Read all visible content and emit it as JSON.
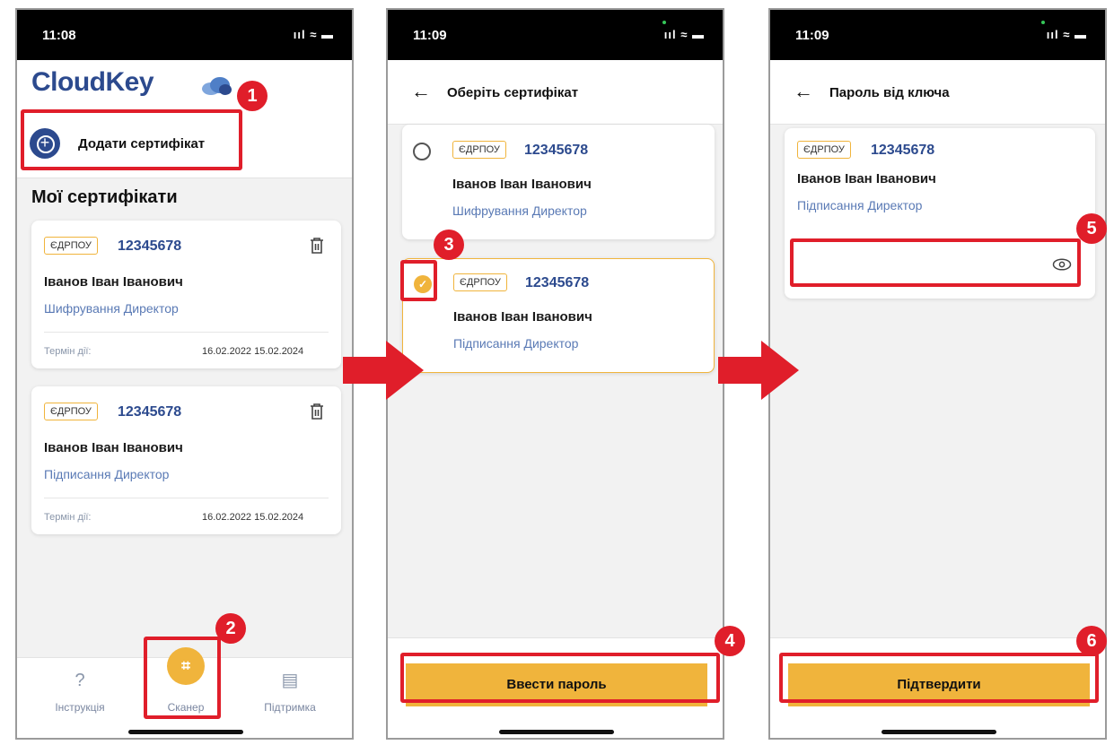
{
  "phone1": {
    "status": {
      "time": "11:08",
      "indicators": "ııl ≈ ▬"
    },
    "brand": "CloudKey",
    "add_certificate": "Додати сертифікат",
    "section_title": "Мої сертифікати",
    "cards": [
      {
        "badge": "ЄДРПОУ",
        "code": "12345678",
        "name": "Іванов Іван Іванович",
        "role": "Шифрування  Директор",
        "validity_label": "Термін дії:",
        "validity_dates": "16.02.2022  15.02.2024"
      },
      {
        "badge": "ЄДРПОУ",
        "code": "12345678",
        "name": "Іванов Іван Іванович",
        "role": "Підписання  Директор",
        "validity_label": "Термін дії:",
        "validity_dates": "16.02.2022  15.02.2024"
      }
    ],
    "nav": {
      "instructions": "Інструкція",
      "scanner": "Сканер",
      "support": "Підтримка"
    }
  },
  "phone2": {
    "status": {
      "time": "11:09",
      "indicators": "ııl ≈ ▬"
    },
    "title": "Оберіть сертифікат",
    "cards": [
      {
        "badge": "ЄДРПОУ",
        "code": "12345678",
        "name": "Іванов Іван Іванович",
        "role": "Шифрування  Директор"
      },
      {
        "badge": "ЄДРПОУ",
        "code": "12345678",
        "name": "Іванов Іван Іванович",
        "role": "Підписання  Директор"
      }
    ],
    "button": "Ввести пароль"
  },
  "phone3": {
    "status": {
      "time": "11:09",
      "indicators": "ııl ≈ ▬"
    },
    "title": "Пароль від ключа",
    "card": {
      "badge": "ЄДРПОУ",
      "code": "12345678",
      "name": "Іванов Іван Іванович",
      "role": "Підписання  Директор"
    },
    "password_value": "",
    "button": "Підтвердити"
  },
  "steps": [
    "1",
    "2",
    "3",
    "4",
    "5",
    "6"
  ],
  "colors": {
    "accent": "#f0b43c",
    "brand": "#2c4a8e",
    "highlight": "#e01e2a"
  },
  "icons": [
    "back-arrow-icon",
    "cloud-icon",
    "plus-circle-icon",
    "trash-icon",
    "help-icon",
    "scan-icon",
    "chat-icon",
    "check-icon",
    "eye-icon"
  ]
}
